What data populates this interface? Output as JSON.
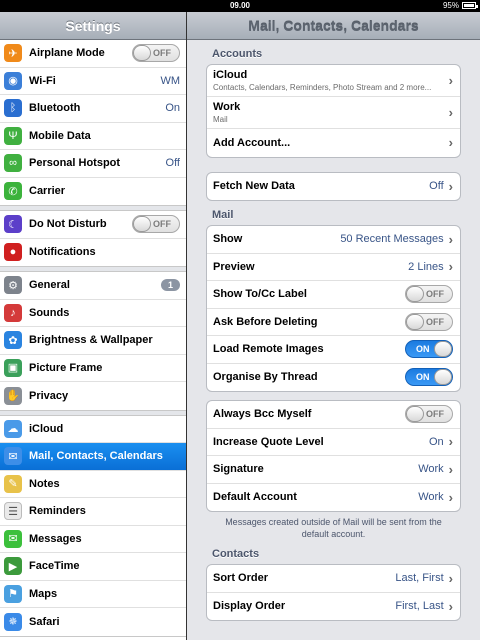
{
  "status": {
    "time": "09.00",
    "battery": "95%"
  },
  "master": {
    "title": "Settings",
    "groups": [
      [
        {
          "icon": "airplane-icon",
          "color": "#f08a1a",
          "glyph": "✈",
          "label": "Airplane Mode",
          "toggle": "OFF"
        },
        {
          "icon": "wifi-icon",
          "color": "#3b7fd8",
          "glyph": "◉",
          "label": "Wi-Fi",
          "value": "WM"
        },
        {
          "icon": "bluetooth-icon",
          "color": "#2a6ed0",
          "glyph": "ᛒ",
          "label": "Bluetooth",
          "value": "On"
        },
        {
          "icon": "antenna-icon",
          "color": "#40b040",
          "glyph": "Ψ",
          "label": "Mobile Data"
        },
        {
          "icon": "link-icon",
          "color": "#40b040",
          "glyph": "∞",
          "label": "Personal Hotspot",
          "value": "Off"
        },
        {
          "icon": "phone-icon",
          "color": "#3cb33c",
          "glyph": "✆",
          "label": "Carrier"
        }
      ],
      [
        {
          "icon": "moon-icon",
          "color": "#5c3fc9",
          "glyph": "☾",
          "label": "Do Not Disturb",
          "toggle": "OFF"
        },
        {
          "icon": "notifications-icon",
          "color": "#d02020",
          "glyph": "●",
          "label": "Notifications"
        }
      ],
      [
        {
          "icon": "gear-icon",
          "color": "#7d838c",
          "glyph": "⚙",
          "label": "General",
          "badge": "1"
        },
        {
          "icon": "speaker-icon",
          "color": "#d43a3a",
          "glyph": "♪",
          "label": "Sounds"
        },
        {
          "icon": "flower-icon",
          "color": "#2a84e0",
          "glyph": "✿",
          "label": "Brightness & Wallpaper"
        },
        {
          "icon": "picture-frame-icon",
          "color": "#3aa05a",
          "glyph": "▣",
          "label": "Picture Frame"
        },
        {
          "icon": "hand-icon",
          "color": "#8a8f96",
          "glyph": "✋",
          "label": "Privacy"
        }
      ],
      [
        {
          "icon": "cloud-icon",
          "color": "#4a9ae8",
          "glyph": "☁",
          "label": "iCloud"
        },
        {
          "icon": "envelope-icon",
          "color": "#3d8ee8",
          "glyph": "✉",
          "label": "Mail, Contacts, Calendars",
          "selected": true
        },
        {
          "icon": "notes-icon",
          "color": "#e8c24a",
          "glyph": "✎",
          "label": "Notes"
        },
        {
          "icon": "reminders-icon",
          "color": "#eaeaea",
          "glyph": "☰",
          "label": "Reminders"
        },
        {
          "icon": "messages-icon",
          "color": "#3cc03c",
          "glyph": "✉",
          "label": "Messages"
        },
        {
          "icon": "facetime-icon",
          "color": "#3c9a3c",
          "glyph": "▶",
          "label": "FaceTime"
        },
        {
          "icon": "maps-icon",
          "color": "#4aa0e0",
          "glyph": "⚑",
          "label": "Maps"
        },
        {
          "icon": "compass-icon",
          "color": "#3a8ae8",
          "glyph": "✵",
          "label": "Safari"
        }
      ]
    ]
  },
  "detail": {
    "title": "Mail, Contacts, Calendars",
    "accounts_header": "Accounts",
    "accounts": [
      {
        "label": "iCloud",
        "sub": "Contacts, Calendars, Reminders, Photo Stream and 2 more..."
      },
      {
        "label": "Work",
        "sub": "Mail"
      },
      {
        "label": "Add Account..."
      }
    ],
    "fetch": {
      "label": "Fetch New Data",
      "value": "Off"
    },
    "mail_header": "Mail",
    "mail": [
      {
        "label": "Show",
        "value": "50 Recent Messages",
        "chevron": true
      },
      {
        "label": "Preview",
        "value": "2 Lines",
        "chevron": true
      },
      {
        "label": "Show To/Cc Label",
        "toggle": "OFF"
      },
      {
        "label": "Ask Before Deleting",
        "toggle": "OFF"
      },
      {
        "label": "Load Remote Images",
        "toggle": "ON"
      },
      {
        "label": "Organise By Thread",
        "toggle": "ON"
      }
    ],
    "mail2": [
      {
        "label": "Always Bcc Myself",
        "toggle": "OFF"
      },
      {
        "label": "Increase Quote Level",
        "value": "On",
        "chevron": true
      },
      {
        "label": "Signature",
        "value": "Work",
        "chevron": true
      },
      {
        "label": "Default Account",
        "value": "Work",
        "chevron": true
      }
    ],
    "footnote": "Messages created outside of Mail will be sent from the default account.",
    "contacts_header": "Contacts",
    "contacts": [
      {
        "label": "Sort Order",
        "value": "Last, First",
        "chevron": true
      },
      {
        "label": "Display Order",
        "value": "First, Last",
        "chevron": true
      }
    ],
    "chevron_glyph": "›"
  }
}
